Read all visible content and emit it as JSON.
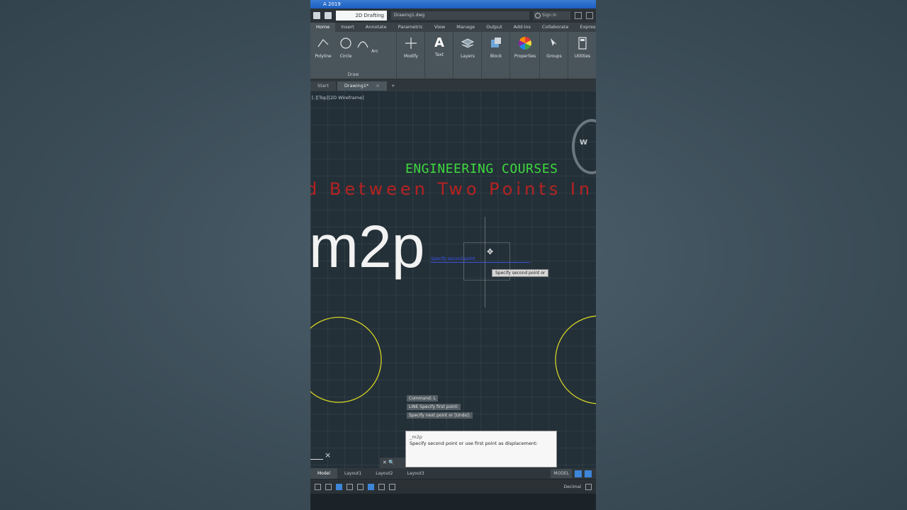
{
  "window": {
    "title": "A 2019"
  },
  "quick_access": {
    "workspace": "2D Drafting",
    "doc_title": "Drawing1.dwg",
    "search": "Sign In"
  },
  "ribbon": {
    "tabs": [
      "Home",
      "Insert",
      "Annotate",
      "Parametric",
      "View",
      "Manage",
      "Output",
      "Add-ins",
      "Collaborate",
      "Express"
    ],
    "active_tab": "Home",
    "draw_buttons": [
      "Polyline",
      "Circle",
      "Arc"
    ],
    "draw_group": "Draw",
    "tools": [
      "Modify",
      "Text",
      "Layers",
      "Block",
      "Properties",
      "Groups",
      "Utilities"
    ]
  },
  "file_tabs": {
    "start": "Start",
    "active": "Drawing1*"
  },
  "canvas": {
    "viewport_label": "[-][Top][2D Wireframe]",
    "viewcube_letter": "W",
    "green_heading": "ENGINEERING COURSES",
    "red_heading": "d Between Two Points In Au",
    "big_label": "m2p",
    "dimension_text": "Specify second point",
    "tooltip": "Specify second point or",
    "circle_color": "#d4d425"
  },
  "command": {
    "history": [
      "Command: L",
      "LINE Specify first point:",
      "Specify next point or [Undo]:",
      "Specify second point:"
    ],
    "prompt_label": "_m2p",
    "prompt_text": "Specify second point or use first point as displacement:",
    "toolbar_text": "✕ 🔍"
  },
  "layout_tabs": [
    "Model",
    "Layout1",
    "Layout2",
    "Layout3"
  ],
  "status": {
    "model": "MODEL",
    "annotation": "Decimal"
  },
  "colors": {
    "accent_blue": "#3d86d8",
    "canvas_bg": "#243038",
    "heading_green": "#3dd93d",
    "heading_red": "#b52222"
  }
}
